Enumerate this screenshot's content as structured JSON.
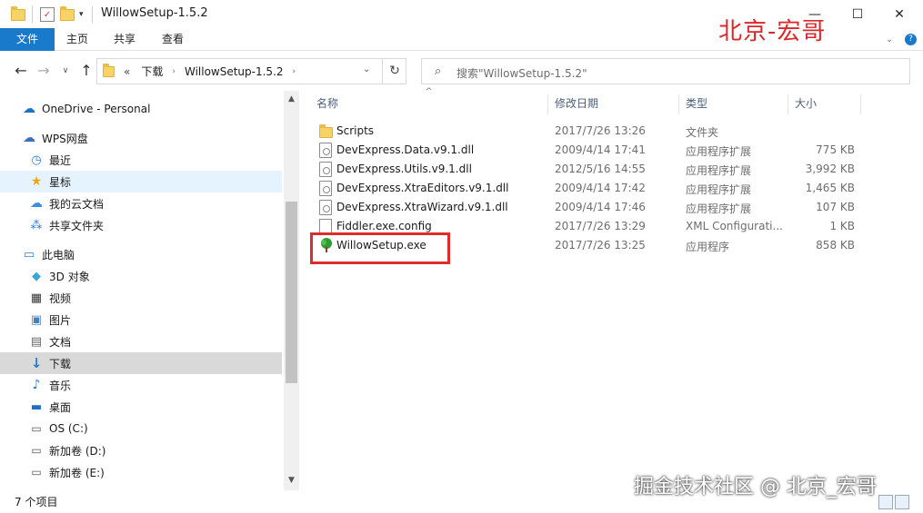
{
  "window": {
    "title": "WillowSetup-1.5.2",
    "minimize": "—",
    "maximize": "☐",
    "close": "✕"
  },
  "watermark_top": "北京-宏哥",
  "watermark_bottom": "掘金技术社区 @ 北京_宏哥",
  "ribbon": {
    "tabs": [
      "文件",
      "主页",
      "共享",
      "查看"
    ]
  },
  "address": {
    "prefix": "«",
    "crumbs": [
      "下载",
      "WillowSetup-1.5.2"
    ]
  },
  "search": {
    "placeholder": "搜索\"WillowSetup-1.5.2\""
  },
  "nav": {
    "items": [
      {
        "label": "OneDrive - Personal",
        "icon": "cloud-icon"
      },
      {
        "label": "WPS网盘",
        "icon": "cloud-icon"
      },
      {
        "label": "最近",
        "icon": "clock-icon"
      },
      {
        "label": "星标",
        "icon": "star-icon"
      },
      {
        "label": "我的云文档",
        "icon": "cloud-icon"
      },
      {
        "label": "共享文件夹",
        "icon": "share-icon"
      },
      {
        "label": "此电脑",
        "icon": "computer-icon"
      },
      {
        "label": "3D 对象",
        "icon": "cube-icon"
      },
      {
        "label": "视频",
        "icon": "video-icon"
      },
      {
        "label": "图片",
        "icon": "picture-icon"
      },
      {
        "label": "文档",
        "icon": "document-icon"
      },
      {
        "label": "下载",
        "icon": "download-icon"
      },
      {
        "label": "音乐",
        "icon": "music-icon"
      },
      {
        "label": "桌面",
        "icon": "desktop-icon"
      },
      {
        "label": "OS (C:)",
        "icon": "drive-icon"
      },
      {
        "label": "新加卷 (D:)",
        "icon": "drive-icon"
      },
      {
        "label": "新加卷 (E:)",
        "icon": "drive-icon"
      }
    ]
  },
  "columns": {
    "name": "名称",
    "date": "修改日期",
    "type": "类型",
    "size": "大小"
  },
  "files": [
    {
      "name": "Scripts",
      "date": "2017/7/26 13:26",
      "type": "文件夹",
      "size": "",
      "icon": "folder-icon"
    },
    {
      "name": "DevExpress.Data.v9.1.dll",
      "date": "2009/4/14 17:41",
      "type": "应用程序扩展",
      "size": "775 KB",
      "icon": "dll-icon"
    },
    {
      "name": "DevExpress.Utils.v9.1.dll",
      "date": "2012/5/16 14:55",
      "type": "应用程序扩展",
      "size": "3,992 KB",
      "icon": "dll-icon"
    },
    {
      "name": "DevExpress.XtraEditors.v9.1.dll",
      "date": "2009/4/14 17:42",
      "type": "应用程序扩展",
      "size": "1,465 KB",
      "icon": "dll-icon"
    },
    {
      "name": "DevExpress.XtraWizard.v9.1.dll",
      "date": "2009/4/14 17:46",
      "type": "应用程序扩展",
      "size": "107 KB",
      "icon": "dll-icon"
    },
    {
      "name": "Fiddler.exe.config",
      "date": "2017/7/26 13:29",
      "type": "XML Configurati...",
      "size": "1 KB",
      "icon": "file-icon"
    },
    {
      "name": "WillowSetup.exe",
      "date": "2017/7/26 13:25",
      "type": "应用程序",
      "size": "858 KB",
      "icon": "tree-icon"
    }
  ],
  "status": {
    "count": "7 个项目"
  },
  "colors": {
    "accent": "#1979ca",
    "highlight_box": "#e12a2a",
    "watermark_red": "#d9282a"
  }
}
